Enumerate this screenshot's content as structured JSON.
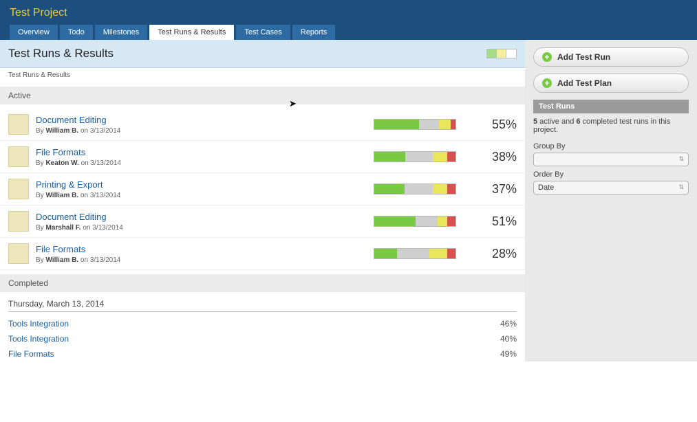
{
  "header": {
    "project_title": "Test Project"
  },
  "tabs": [
    {
      "label": "Overview"
    },
    {
      "label": "Todo"
    },
    {
      "label": "Milestones"
    },
    {
      "label": "Test Runs & Results",
      "active": true
    },
    {
      "label": "Test Cases"
    },
    {
      "label": "Reports"
    }
  ],
  "page": {
    "title": "Test Runs & Results",
    "breadcrumb": "Test Runs & Results"
  },
  "sections": {
    "active_label": "Active",
    "completed_label": "Completed"
  },
  "active_runs": [
    {
      "title": "Document Editing",
      "by_prefix": "By ",
      "author": "William B.",
      "on_text": " on 3/13/2014",
      "pct": "55%",
      "bars": {
        "pass": 55,
        "blk": 25,
        "retest": 14,
        "fail": 6
      }
    },
    {
      "title": "File Formats",
      "by_prefix": "By ",
      "author": "Keaton W.",
      "on_text": " on 3/13/2014",
      "pct": "38%",
      "bars": {
        "pass": 38,
        "blk": 34,
        "retest": 18,
        "fail": 10
      }
    },
    {
      "title": "Printing & Export",
      "by_prefix": "By ",
      "author": "William B.",
      "on_text": " on 3/13/2014",
      "pct": "37%",
      "bars": {
        "pass": 37,
        "blk": 35,
        "retest": 18,
        "fail": 10
      }
    },
    {
      "title": "Document Editing",
      "by_prefix": "By ",
      "author": "Marshall F.",
      "on_text": " on 3/13/2014",
      "pct": "51%",
      "bars": {
        "pass": 51,
        "blk": 27,
        "retest": 12,
        "fail": 10
      }
    },
    {
      "title": "File Formats",
      "by_prefix": "By ",
      "author": "William B.",
      "on_text": " on 3/13/2014",
      "pct": "28%",
      "bars": {
        "pass": 28,
        "blk": 40,
        "retest": 22,
        "fail": 10
      }
    }
  ],
  "completed": {
    "date_label": "Thursday, March 13, 2014",
    "runs": [
      {
        "title": "Tools Integration",
        "pct": "46%"
      },
      {
        "title": "Tools Integration",
        "pct": "40%"
      },
      {
        "title": "File Formats",
        "pct": "49%"
      }
    ]
  },
  "sidebar": {
    "add_run_label": "Add Test Run",
    "add_plan_label": "Add Test Plan",
    "section_hdr": "Test Runs",
    "summary_a": "5",
    "summary_mid": " active and ",
    "summary_b": "6",
    "summary_end": " completed test runs in this project.",
    "group_by_label": "Group By",
    "group_by_value": "",
    "order_by_label": "Order By",
    "order_by_value": "Date"
  }
}
